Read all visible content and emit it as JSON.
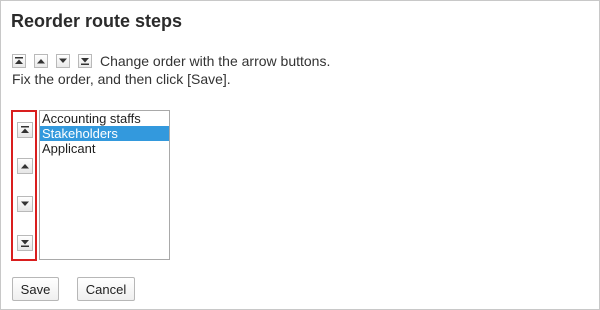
{
  "page": {
    "title": "Reorder route steps",
    "instructions": {
      "line1": "Change order with the arrow buttons.",
      "line2": "Fix the order, and then click [Save]."
    }
  },
  "reorder": {
    "buttons": [
      {
        "name": "move-to-top",
        "icon": "double-up-arrow-icon"
      },
      {
        "name": "move-up",
        "icon": "up-arrow-icon"
      },
      {
        "name": "move-down",
        "icon": "down-arrow-icon"
      },
      {
        "name": "move-to-bottom",
        "icon": "double-down-arrow-icon"
      }
    ],
    "highlight_color": "#d91e1e"
  },
  "list": {
    "items": [
      {
        "label": "Accounting staffs",
        "selected": false
      },
      {
        "label": "Stakeholders",
        "selected": true
      },
      {
        "label": "Applicant",
        "selected": false
      }
    ],
    "selected_color": "#3399dd"
  },
  "actions": {
    "save_label": "Save",
    "cancel_label": "Cancel"
  }
}
